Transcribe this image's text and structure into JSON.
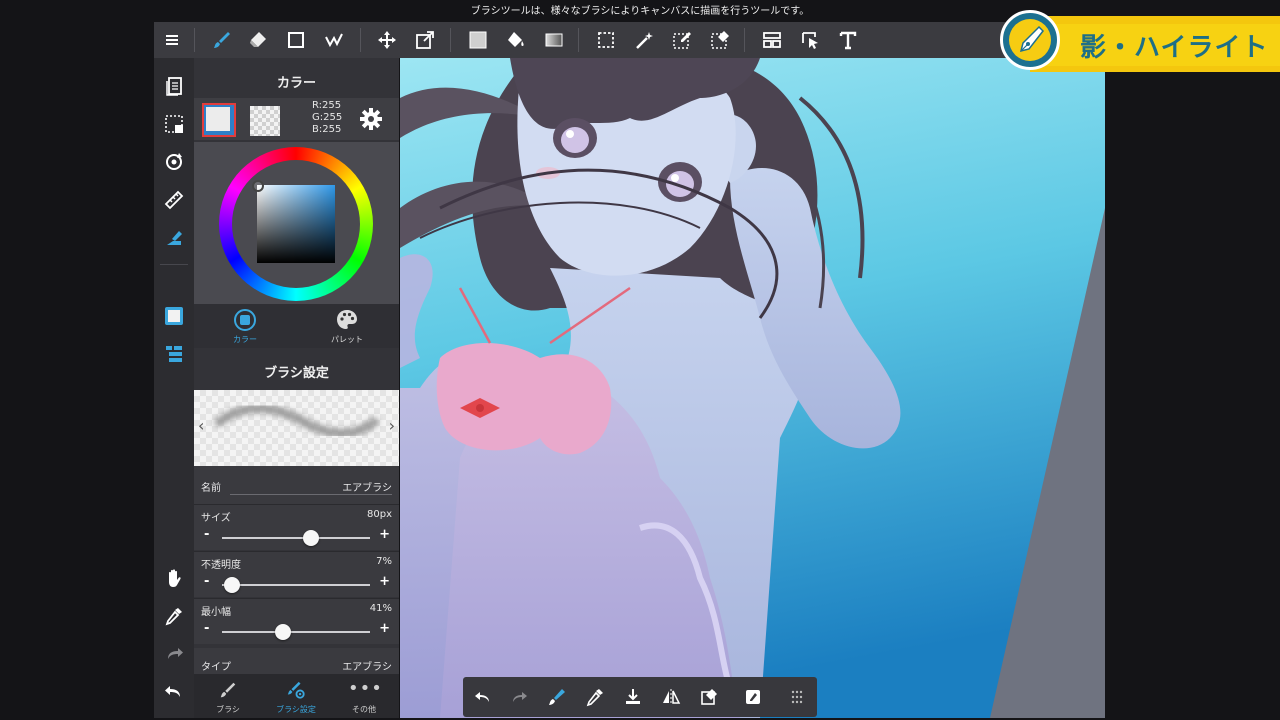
{
  "hint_text": "ブラシツールは、様々なブラシによりキャンバスに描画を行うツールです。",
  "toolbar": {
    "items": [
      "menu-icon",
      "brush-tool-icon",
      "eraser-tool-icon",
      "shape-tool-icon",
      "select-pen-icon",
      "move-icon",
      "transform-icon",
      "fill-color-icon",
      "bucket-icon",
      "gradient-icon",
      "select-rect-icon",
      "magic-wand-icon",
      "select-pen-tool-icon",
      "select-eraser-icon",
      "layout-icon",
      "select-cursor-icon",
      "text-icon"
    ]
  },
  "panel": {
    "color_title": "カラー",
    "rgb": {
      "r": "R:255",
      "g": "G:255",
      "b": "B:255"
    },
    "tab_color": "カラー",
    "tab_palette": "パレット",
    "brush_settings_title": "ブラシ設定",
    "name_key": "名前",
    "name_value": "エアブラシ",
    "size_key": "サイズ",
    "size_value": "80px",
    "size_level": 0.6,
    "opacity_key": "不透明度",
    "opacity_value": "7%",
    "opacity_level": 0.07,
    "minwidth_key": "最小幅",
    "minwidth_value": "41%",
    "minwidth_level": 0.41,
    "type_key": "タイプ",
    "type_value": "エアブラシ",
    "minus": "-",
    "plus": "+",
    "bottom_tabs": [
      "ブラシ",
      "ブラシ設定",
      "その他"
    ]
  },
  "badge": {
    "text": "影・ハイライト"
  },
  "colors": {
    "accent_blue": "#3aa7de",
    "panel_bg": "#333338",
    "badge_yellow": "#f4c70e",
    "badge_text": "#1e6f86",
    "primary_color": "#ffffff"
  }
}
